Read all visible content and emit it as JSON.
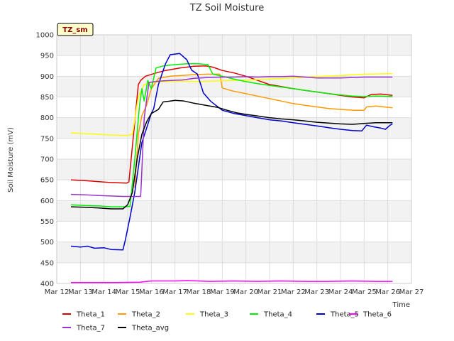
{
  "chart_data": {
    "type": "line",
    "title": "TZ Soil Moisture",
    "badge": "TZ_sm",
    "xlabel": "Time",
    "ylabel": "Soil Moisture (mV)",
    "ylim": [
      400,
      1000
    ],
    "yticks": [
      400,
      450,
      500,
      550,
      600,
      650,
      700,
      750,
      800,
      850,
      900,
      950,
      1000
    ],
    "xlim": [
      12,
      27
    ],
    "xticks": [
      {
        "v": 12,
        "label": "Mar 12"
      },
      {
        "v": 13,
        "label": "Mar 13"
      },
      {
        "v": 14,
        "label": "Mar 14"
      },
      {
        "v": 15,
        "label": "Mar 15"
      },
      {
        "v": 16,
        "label": "Mar 16"
      },
      {
        "v": 17,
        "label": "Mar 17"
      },
      {
        "v": 18,
        "label": "Mar 18"
      },
      {
        "v": 19,
        "label": "Mar 19"
      },
      {
        "v": 20,
        "label": "Mar 20"
      },
      {
        "v": 21,
        "label": "Mar 21"
      },
      {
        "v": 22,
        "label": "Mar 22"
      },
      {
        "v": 23,
        "label": "Mar 23"
      },
      {
        "v": 24,
        "label": "Mar 24"
      },
      {
        "v": 25,
        "label": "Mar 25"
      },
      {
        "v": 26,
        "label": "Mar 26"
      },
      {
        "v": 27,
        "label": "Mar 27"
      }
    ],
    "grid": true,
    "legend_position": "bottom",
    "series": [
      {
        "name": "Theta_1",
        "color": "#dd0000",
        "points": [
          [
            12.6,
            650
          ],
          [
            13.2,
            648
          ],
          [
            13.7,
            646
          ],
          [
            14.2,
            644
          ],
          [
            14.6,
            643
          ],
          [
            14.95,
            642
          ],
          [
            15.05,
            645
          ],
          [
            15.25,
            760
          ],
          [
            15.45,
            880
          ],
          [
            15.55,
            890
          ],
          [
            15.75,
            900
          ],
          [
            16.2,
            908
          ],
          [
            16.6,
            914
          ],
          [
            17.2,
            920
          ],
          [
            17.8,
            924
          ],
          [
            18.3,
            925
          ],
          [
            18.6,
            922
          ],
          [
            19.0,
            914
          ],
          [
            19.5,
            908
          ],
          [
            20.0,
            900
          ],
          [
            20.5,
            890
          ],
          [
            21.0,
            880
          ],
          [
            21.5,
            875
          ],
          [
            22.0,
            870
          ],
          [
            22.5,
            866
          ],
          [
            23.0,
            862
          ],
          [
            23.5,
            858
          ],
          [
            24.0,
            854
          ],
          [
            24.5,
            850
          ],
          [
            25.0,
            848
          ],
          [
            25.3,
            856
          ],
          [
            25.7,
            857
          ],
          [
            26.2,
            854
          ]
        ]
      },
      {
        "name": "Theta_2",
        "color": "#ff9900",
        "points": [
          [
            15.3,
            630
          ],
          [
            15.45,
            760
          ],
          [
            15.6,
            805
          ],
          [
            15.8,
            830
          ],
          [
            16.0,
            870
          ],
          [
            16.3,
            895
          ],
          [
            16.8,
            900
          ],
          [
            17.3,
            902
          ],
          [
            17.8,
            904
          ],
          [
            18.4,
            905
          ],
          [
            18.9,
            905
          ],
          [
            19.0,
            872
          ],
          [
            19.4,
            865
          ],
          [
            20.0,
            858
          ],
          [
            20.5,
            852
          ],
          [
            21.0,
            846
          ],
          [
            21.5,
            840
          ],
          [
            22.0,
            834
          ],
          [
            22.5,
            830
          ],
          [
            23.0,
            826
          ],
          [
            23.5,
            822
          ],
          [
            24.0,
            820
          ],
          [
            24.6,
            818
          ],
          [
            25.0,
            818
          ],
          [
            25.1,
            826
          ],
          [
            25.5,
            828
          ],
          [
            26.2,
            824
          ]
        ]
      },
      {
        "name": "Theta_3",
        "color": "#ffff00",
        "points": [
          [
            12.6,
            763
          ],
          [
            13.0,
            762
          ],
          [
            13.5,
            761
          ],
          [
            14.0,
            759
          ],
          [
            14.5,
            758
          ],
          [
            15.0,
            757
          ],
          [
            15.2,
            760
          ],
          [
            15.45,
            850
          ],
          [
            15.7,
            880
          ],
          [
            16.0,
            885
          ],
          [
            16.5,
            887
          ],
          [
            17.0,
            888
          ],
          [
            17.5,
            888
          ],
          [
            18.0,
            887
          ],
          [
            18.5,
            888
          ],
          [
            19.0,
            889
          ],
          [
            19.5,
            890
          ],
          [
            20.0,
            891
          ],
          [
            21.0,
            893
          ],
          [
            22.0,
            896
          ],
          [
            23.0,
            899
          ],
          [
            24.0,
            902
          ],
          [
            25.0,
            905
          ],
          [
            26.2,
            906
          ]
        ]
      },
      {
        "name": "Theta_4",
        "color": "#00ee00",
        "points": [
          [
            12.6,
            590
          ],
          [
            13.2,
            588
          ],
          [
            13.8,
            587
          ],
          [
            14.3,
            585
          ],
          [
            14.8,
            585
          ],
          [
            15.1,
            586
          ],
          [
            15.3,
            700
          ],
          [
            15.5,
            830
          ],
          [
            15.6,
            870
          ],
          [
            15.7,
            840
          ],
          [
            15.85,
            890
          ],
          [
            16.0,
            870
          ],
          [
            16.2,
            920
          ],
          [
            16.5,
            925
          ],
          [
            17.0,
            928
          ],
          [
            17.5,
            930
          ],
          [
            18.0,
            930
          ],
          [
            18.4,
            928
          ],
          [
            18.6,
            905
          ],
          [
            19.0,
            900
          ],
          [
            19.5,
            893
          ],
          [
            20.0,
            887
          ],
          [
            20.5,
            882
          ],
          [
            21.0,
            878
          ],
          [
            21.5,
            874
          ],
          [
            22.0,
            870
          ],
          [
            22.5,
            866
          ],
          [
            23.0,
            862
          ],
          [
            23.5,
            858
          ],
          [
            24.0,
            855
          ],
          [
            24.5,
            852
          ],
          [
            25.0,
            851
          ],
          [
            25.5,
            852
          ],
          [
            26.2,
            851
          ]
        ]
      },
      {
        "name": "Theta_5",
        "color": "#0000cc",
        "points": [
          [
            12.6,
            490
          ],
          [
            13.0,
            488
          ],
          [
            13.3,
            490
          ],
          [
            13.6,
            485
          ],
          [
            14.0,
            486
          ],
          [
            14.3,
            482
          ],
          [
            14.8,
            481
          ],
          [
            14.9,
            505
          ],
          [
            15.1,
            560
          ],
          [
            15.3,
            620
          ],
          [
            15.45,
            680
          ],
          [
            15.6,
            740
          ],
          [
            15.8,
            775
          ],
          [
            16.0,
            810
          ],
          [
            16.1,
            822
          ],
          [
            16.3,
            880
          ],
          [
            16.6,
            930
          ],
          [
            16.8,
            952
          ],
          [
            17.2,
            955
          ],
          [
            17.5,
            940
          ],
          [
            17.7,
            915
          ],
          [
            17.95,
            905
          ],
          [
            18.2,
            860
          ],
          [
            18.5,
            840
          ],
          [
            19.0,
            818
          ],
          [
            19.5,
            810
          ],
          [
            20.0,
            805
          ],
          [
            20.5,
            800
          ],
          [
            21.0,
            795
          ],
          [
            21.5,
            792
          ],
          [
            22.0,
            788
          ],
          [
            22.5,
            784
          ],
          [
            23.0,
            780
          ],
          [
            23.5,
            776
          ],
          [
            24.0,
            772
          ],
          [
            24.5,
            769
          ],
          [
            24.9,
            768
          ],
          [
            25.1,
            782
          ],
          [
            25.4,
            778
          ],
          [
            25.7,
            775
          ],
          [
            25.9,
            772
          ],
          [
            26.1,
            782
          ],
          [
            26.2,
            785
          ]
        ]
      },
      {
        "name": "Theta_6",
        "color": "#ff00ff",
        "points": [
          [
            12.6,
            402
          ],
          [
            13.5,
            402
          ],
          [
            14.5,
            402
          ],
          [
            15.5,
            403
          ],
          [
            16.0,
            406
          ],
          [
            17.0,
            406
          ],
          [
            17.5,
            407
          ],
          [
            18.5,
            405
          ],
          [
            19.5,
            406
          ],
          [
            20.5,
            405
          ],
          [
            21.5,
            406
          ],
          [
            22.5,
            405
          ],
          [
            23.5,
            405
          ],
          [
            24.5,
            406
          ],
          [
            25.5,
            405
          ],
          [
            26.2,
            405
          ]
        ]
      },
      {
        "name": "Theta_7",
        "color": "#9933cc",
        "points": [
          [
            12.6,
            615
          ],
          [
            13.2,
            614
          ],
          [
            13.8,
            612
          ],
          [
            14.3,
            611
          ],
          [
            14.8,
            610
          ],
          [
            15.2,
            610
          ],
          [
            15.55,
            610
          ],
          [
            15.7,
            800
          ],
          [
            15.9,
            885
          ],
          [
            16.3,
            888
          ],
          [
            16.8,
            890
          ],
          [
            17.3,
            891
          ],
          [
            17.8,
            895
          ],
          [
            18.4,
            897
          ],
          [
            19.0,
            898
          ],
          [
            19.5,
            898
          ],
          [
            20.0,
            899
          ],
          [
            20.5,
            898
          ],
          [
            21.0,
            899
          ],
          [
            21.5,
            899
          ],
          [
            22.0,
            900
          ],
          [
            22.5,
            898
          ],
          [
            23.0,
            896
          ],
          [
            23.5,
            896
          ],
          [
            24.0,
            896
          ],
          [
            24.5,
            897
          ],
          [
            25.0,
            898
          ],
          [
            25.5,
            898
          ],
          [
            26.2,
            898
          ]
        ]
      },
      {
        "name": "Theta_avg",
        "color": "#000000",
        "points": [
          [
            12.6,
            585
          ],
          [
            13.2,
            584
          ],
          [
            13.8,
            582
          ],
          [
            14.3,
            580
          ],
          [
            14.8,
            580
          ],
          [
            15.0,
            590
          ],
          [
            15.2,
            620
          ],
          [
            15.4,
            700
          ],
          [
            15.6,
            760
          ],
          [
            15.8,
            790
          ],
          [
            16.0,
            810
          ],
          [
            16.3,
            820
          ],
          [
            16.5,
            838
          ],
          [
            16.8,
            840
          ],
          [
            17.0,
            842
          ],
          [
            17.4,
            840
          ],
          [
            17.8,
            835
          ],
          [
            18.3,
            830
          ],
          [
            18.8,
            825
          ],
          [
            19.2,
            818
          ],
          [
            19.6,
            812
          ],
          [
            20.0,
            808
          ],
          [
            20.5,
            804
          ],
          [
            21.0,
            800
          ],
          [
            21.5,
            797
          ],
          [
            22.0,
            795
          ],
          [
            22.5,
            792
          ],
          [
            23.0,
            789
          ],
          [
            23.5,
            787
          ],
          [
            24.0,
            785
          ],
          [
            24.5,
            784
          ],
          [
            25.0,
            786
          ],
          [
            25.5,
            788
          ],
          [
            26.2,
            788
          ]
        ]
      }
    ]
  }
}
